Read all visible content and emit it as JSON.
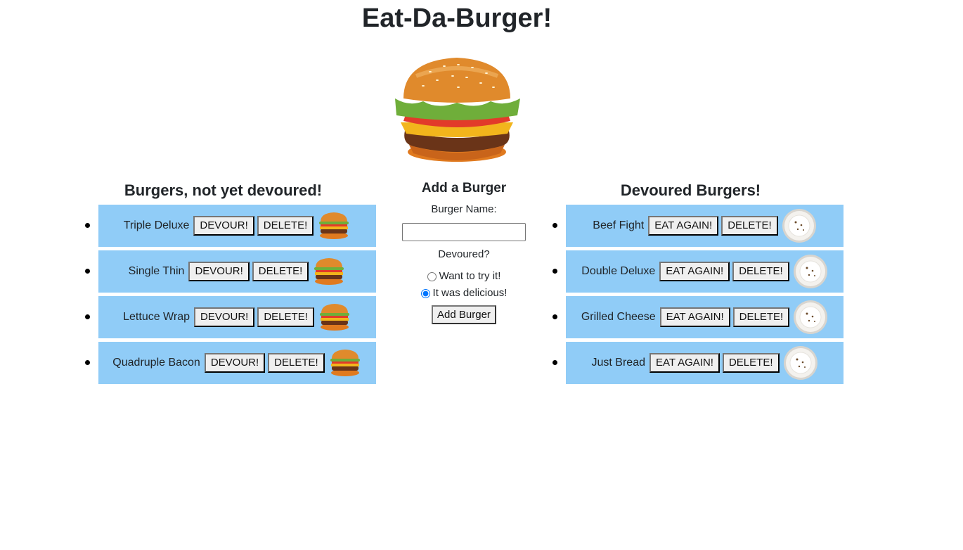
{
  "page": {
    "title": "Eat-Da-Burger!"
  },
  "left": {
    "title": "Burgers, not yet devoured!",
    "action_label": "DEVOUR!",
    "delete_label": "DELETE!",
    "items": [
      {
        "name": "Triple Deluxe"
      },
      {
        "name": "Single Thin"
      },
      {
        "name": "Lettuce Wrap"
      },
      {
        "name": "Quadruple Bacon"
      }
    ]
  },
  "form": {
    "title": "Add a Burger",
    "name_label": "Burger Name:",
    "name_value": "",
    "devoured_label": "Devoured?",
    "option_try": "Want to try it!",
    "option_delicious": "It was delicious!",
    "selected_option": "It was delicious!",
    "submit_label": "Add Burger"
  },
  "right": {
    "title": "Devoured Burgers!",
    "action_label": "EAT AGAIN!",
    "delete_label": "DELETE!",
    "items": [
      {
        "name": "Beef Fight"
      },
      {
        "name": "Double Deluxe"
      },
      {
        "name": "Grilled Cheese"
      },
      {
        "name": "Just Bread"
      }
    ]
  },
  "colors": {
    "row_bg": "#90ccf7",
    "text": "#212529"
  }
}
